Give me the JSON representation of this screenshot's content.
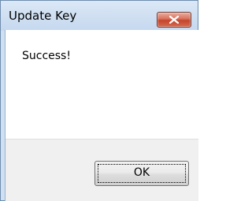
{
  "window": {
    "title": "Update Key",
    "message": "Success!",
    "ok_label": "OK"
  },
  "icons": {
    "close": "close-icon"
  },
  "colors": {
    "frame": "#cfe0f2",
    "close_button": "#c3452c",
    "footer": "#f0f0f0"
  }
}
